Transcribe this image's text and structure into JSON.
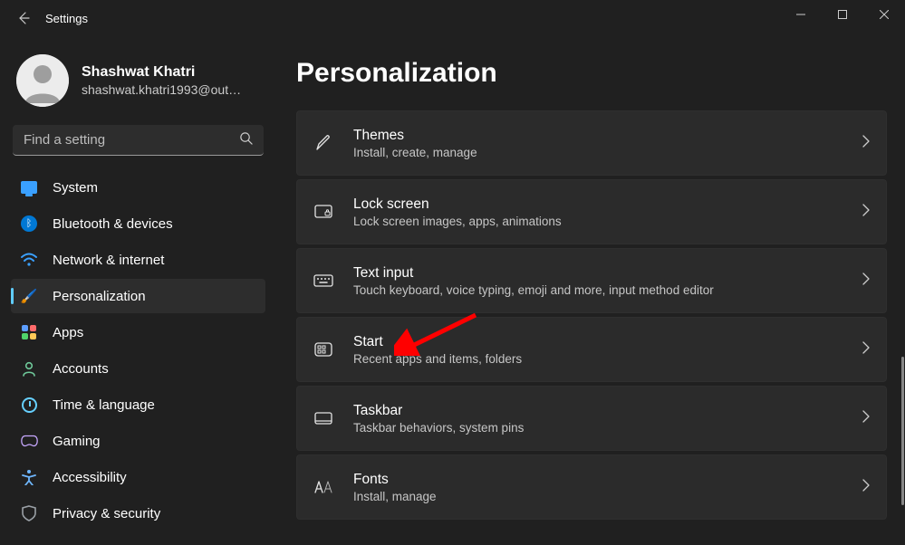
{
  "window": {
    "title": "Settings"
  },
  "profile": {
    "name": "Shashwat Khatri",
    "email": "shashwat.khatri1993@out…"
  },
  "search": {
    "placeholder": "Find a setting"
  },
  "nav": {
    "items": [
      {
        "id": "system",
        "label": "System"
      },
      {
        "id": "bluetooth",
        "label": "Bluetooth & devices"
      },
      {
        "id": "network",
        "label": "Network & internet"
      },
      {
        "id": "personalization",
        "label": "Personalization",
        "active": true
      },
      {
        "id": "apps",
        "label": "Apps"
      },
      {
        "id": "accounts",
        "label": "Accounts"
      },
      {
        "id": "time",
        "label": "Time & language"
      },
      {
        "id": "gaming",
        "label": "Gaming"
      },
      {
        "id": "accessibility",
        "label": "Accessibility"
      },
      {
        "id": "privacy",
        "label": "Privacy & security"
      }
    ]
  },
  "page": {
    "title": "Personalization",
    "cards": [
      {
        "id": "themes",
        "title": "Themes",
        "sub": "Install, create, manage"
      },
      {
        "id": "lockscreen",
        "title": "Lock screen",
        "sub": "Lock screen images, apps, animations"
      },
      {
        "id": "textinput",
        "title": "Text input",
        "sub": "Touch keyboard, voice typing, emoji and more, input method editor"
      },
      {
        "id": "start",
        "title": "Start",
        "sub": "Recent apps and items, folders"
      },
      {
        "id": "taskbar",
        "title": "Taskbar",
        "sub": "Taskbar behaviors, system pins"
      },
      {
        "id": "fonts",
        "title": "Fonts",
        "sub": "Install, manage"
      }
    ]
  },
  "annotation": {
    "arrow_target_card": "start",
    "arrow_color": "#ff0000"
  }
}
